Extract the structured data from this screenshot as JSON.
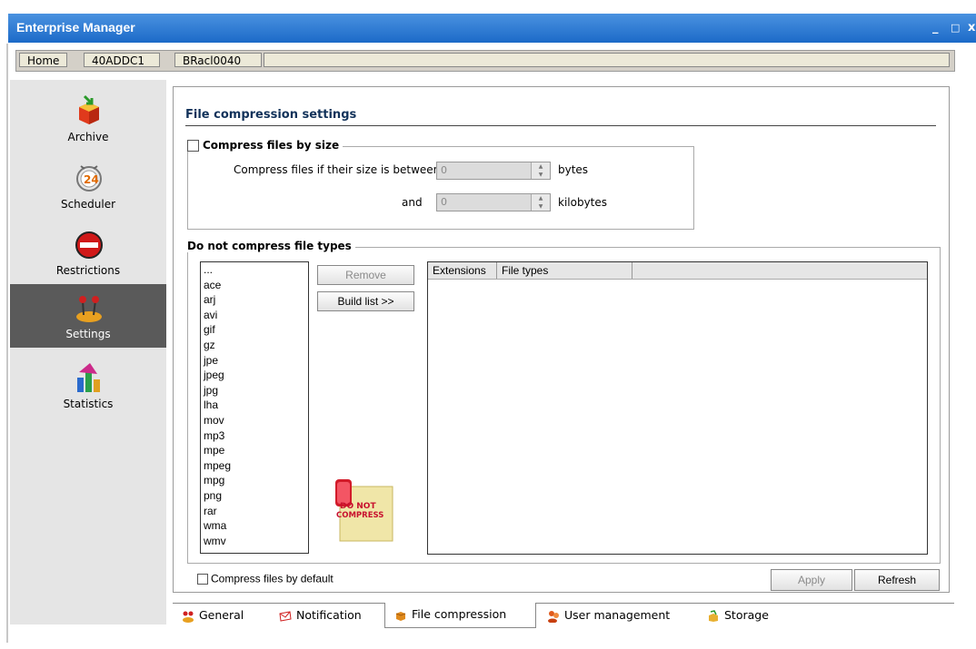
{
  "window": {
    "title": "Enterprise Manager",
    "minimize": "_",
    "maximize": "□",
    "close": "x"
  },
  "breadcrumb": [
    "Home",
    "40ADDC1",
    "BRacl0040"
  ],
  "sidebar": {
    "items": [
      {
        "label": "Archive",
        "icon": "archive-box-icon"
      },
      {
        "label": "Scheduler",
        "icon": "scheduler-clock-icon"
      },
      {
        "label": "Restrictions",
        "icon": "no-entry-icon"
      },
      {
        "label": "Settings",
        "icon": "joystick-settings-icon",
        "active": true
      },
      {
        "label": "Statistics",
        "icon": "bar-chart-icon"
      }
    ]
  },
  "main": {
    "section_title": "File compression settings",
    "compress_by_size": {
      "label": "Compress files by size",
      "checked": false,
      "between_label": "Compress files if their size is between",
      "min_value": "0",
      "min_unit": "bytes",
      "and_label": "and",
      "max_value": "0",
      "max_unit": "kilobytes"
    },
    "exclusions": {
      "title": "Do not compress file types",
      "list": [
        "...",
        "ace",
        "arj",
        "avi",
        "gif",
        "gz",
        "jpe",
        "jpeg",
        "jpg",
        "lha",
        "mov",
        "mp3",
        "mpe",
        "mpeg",
        "mpg",
        "png",
        "rar",
        "wma",
        "wmv"
      ],
      "remove_button": "Remove",
      "build_list_button": "Build list >>",
      "stamp_text": "DO NOT COMPRESS",
      "grid_columns": [
        "Extensions",
        "File types"
      ]
    },
    "compress_by_default": {
      "label": "Compress files by default",
      "checked": false
    },
    "apply_button": "Apply",
    "refresh_button": "Refresh"
  },
  "tabs": [
    {
      "label": "General",
      "active": false
    },
    {
      "label": "Notification",
      "active": false
    },
    {
      "label": "File compression",
      "active": true
    },
    {
      "label": "User management",
      "active": false
    },
    {
      "label": "Storage",
      "active": false
    }
  ],
  "colors": {
    "titlebar": "#1c6ac8",
    "sidebar_bg": "#e5e5e5",
    "sidebar_active": "#5a5a5a",
    "section_title": "#12325a"
  }
}
